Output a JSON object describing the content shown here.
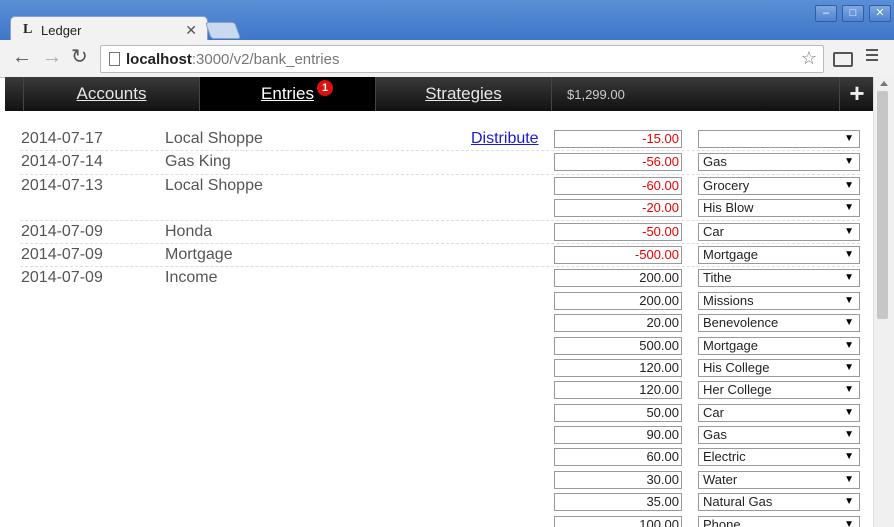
{
  "browser": {
    "tab_title": "Ledger",
    "tab_favicon": "L",
    "url_host": "localhost",
    "url_rest": ":3000/v2/bank_entries"
  },
  "nav": {
    "accounts": "Accounts",
    "entries": "Entries",
    "entries_badge": "1",
    "strategies": "Strategies",
    "balance": "$1,299.00",
    "add": "+"
  },
  "entries": [
    {
      "date": "2014-07-17",
      "payee": "Local Shoppe",
      "action": "Distribute",
      "splits": [
        {
          "amount": "-15.00",
          "category": ""
        }
      ]
    },
    {
      "date": "2014-07-14",
      "payee": "Gas King",
      "splits": [
        {
          "amount": "-56.00",
          "category": "Gas"
        }
      ]
    },
    {
      "date": "2014-07-13",
      "payee": "Local Shoppe",
      "splits": [
        {
          "amount": "-60.00",
          "category": "Grocery"
        },
        {
          "amount": "-20.00",
          "category": "His Blow"
        }
      ]
    },
    {
      "date": "2014-07-09",
      "payee": "Honda",
      "splits": [
        {
          "amount": "-50.00",
          "category": "Car"
        }
      ]
    },
    {
      "date": "2014-07-09",
      "payee": "Mortgage",
      "splits": [
        {
          "amount": "-500.00",
          "category": "Mortgage"
        }
      ]
    },
    {
      "date": "2014-07-09",
      "payee": "Income",
      "splits": [
        {
          "amount": "200.00",
          "category": "Tithe"
        },
        {
          "amount": "200.00",
          "category": "Missions"
        },
        {
          "amount": "20.00",
          "category": "Benevolence"
        },
        {
          "amount": "500.00",
          "category": "Mortgage"
        },
        {
          "amount": "120.00",
          "category": "His College"
        },
        {
          "amount": "120.00",
          "category": "Her College"
        },
        {
          "amount": "50.00",
          "category": "Car"
        },
        {
          "amount": "90.00",
          "category": "Gas"
        },
        {
          "amount": "60.00",
          "category": "Electric"
        },
        {
          "amount": "30.00",
          "category": "Water"
        },
        {
          "amount": "35.00",
          "category": "Natural Gas"
        },
        {
          "amount": "100.00",
          "category": "Phone"
        }
      ]
    }
  ],
  "colors": {
    "negative": "#e00000",
    "link": "#1a1ad0"
  }
}
